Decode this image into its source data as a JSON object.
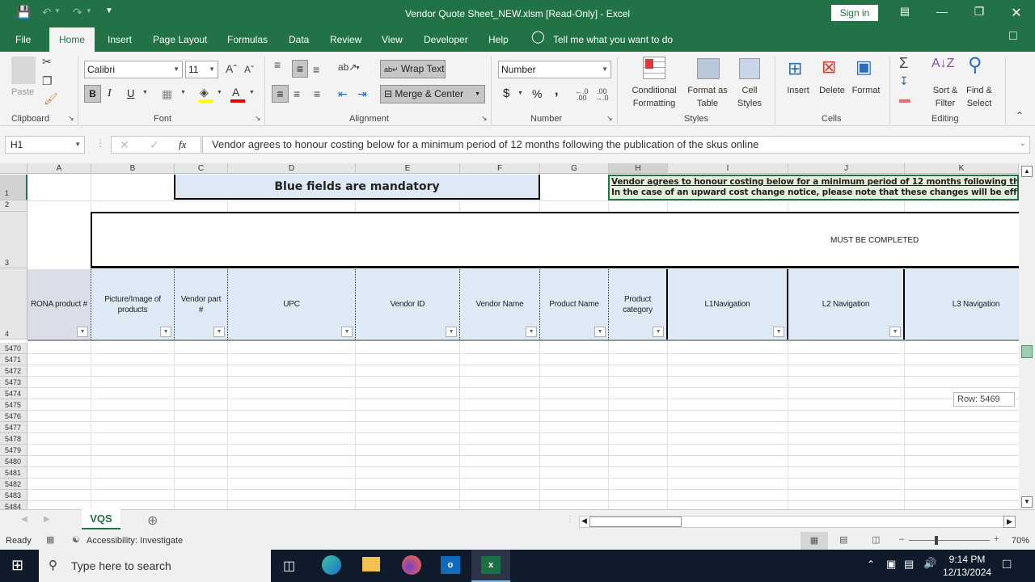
{
  "window": {
    "title": "Vendor Quote Sheet_NEW.xlsm  [Read-Only]  -  Excel",
    "sign_in": "Sign in",
    "qat": {
      "save_icon": "save-icon",
      "undo_icon": "undo-icon",
      "redo_icon": "redo-icon",
      "customize_icon": "customize-qat-icon"
    },
    "controls": [
      "ribbon-display-icon",
      "minimize-icon",
      "restore-icon",
      "close-icon"
    ]
  },
  "ribbon_tabs": [
    "File",
    "Home",
    "Insert",
    "Page Layout",
    "Formulas",
    "Data",
    "Review",
    "View",
    "Developer",
    "Help"
  ],
  "active_tab": "Home",
  "tell_me": "Tell me what you want to do",
  "ribbon": {
    "clipboard": {
      "label": "Clipboard",
      "paste": "Paste"
    },
    "font": {
      "label": "Font",
      "name": "Calibri",
      "size": "11",
      "bold": "B",
      "italic": "I",
      "underline": "U",
      "fill_color": "#ffff00",
      "font_color": "#e00000"
    },
    "alignment": {
      "label": "Alignment",
      "wrap_text": "Wrap Text",
      "merge_center": "Merge & Center"
    },
    "number": {
      "label": "Number",
      "format": "Number",
      "currency": "$",
      "percent": "%",
      "comma": ","
    },
    "styles": {
      "label": "Styles",
      "conditional": [
        "Conditional",
        "Formatting"
      ],
      "format_table": [
        "Format as",
        "Table"
      ],
      "cell_styles": [
        "Cell",
        "Styles"
      ]
    },
    "cells": {
      "label": "Cells",
      "insert": "Insert",
      "delete": "Delete",
      "format": "Format"
    },
    "editing": {
      "label": "Editing",
      "sort_filter": [
        "Sort &",
        "Filter"
      ],
      "find_select": [
        "Find &",
        "Select"
      ]
    }
  },
  "formula_bar": {
    "name_box": "H1",
    "fx": "fx",
    "content": "Vendor agrees to honour costing below for a minimum period of 12 months following the publication of the skus online"
  },
  "grid": {
    "columns": [
      "A",
      "B",
      "C",
      "D",
      "E",
      "F",
      "G",
      "H",
      "I",
      "J",
      "K"
    ],
    "row1_banner": "Blue fields are mandatory",
    "h1_line1": "Vendor agrees to honour costing below for a minimum period of 12 months following the pu",
    "h1_line2": "In the case of an upward cost change notice, please note that these changes will be effecti",
    "row3_text": "MUST BE COMPLETED",
    "header_labels": [
      "RONA product #",
      "Picture/Image of products",
      "Vendor part #",
      "UPC",
      "Vendor ID",
      "Vendor Name",
      "Product Name",
      "Product category",
      "L1Navigation",
      "L2 Navigation",
      "L3 Navigation"
    ],
    "top_rows": [
      "1",
      "2",
      "3",
      "4"
    ],
    "rows": [
      "5470",
      "5471",
      "5472",
      "5473",
      "5474",
      "5475",
      "5476",
      "5477",
      "5478",
      "5479",
      "5480",
      "5481",
      "5482",
      "5483",
      "5484"
    ],
    "scroll_tip": "Row: 5469"
  },
  "sheet_tabs": [
    "VQS"
  ],
  "status": {
    "ready": "Ready",
    "accessibility": "Accessibility: Investigate",
    "zoom": "70%"
  },
  "taskbar": {
    "search_placeholder": "Type here to search",
    "time": "9:14 PM",
    "date": "12/13/2024",
    "apps": [
      "task-view",
      "edge",
      "file-explorer",
      "firefox",
      "outlook",
      "excel"
    ]
  },
  "colors": {
    "excel_green": "#217346",
    "header_blue": "#dde9f5"
  }
}
